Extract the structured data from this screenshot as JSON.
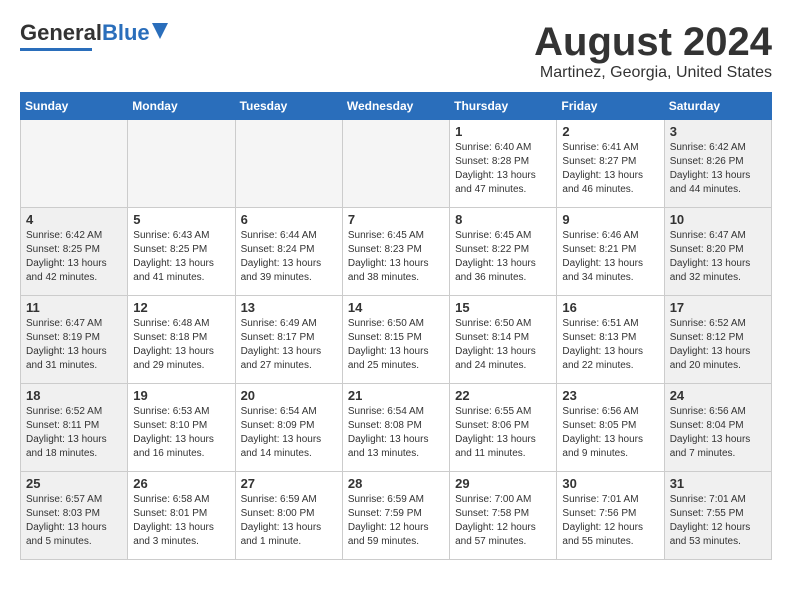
{
  "header": {
    "logo_general": "General",
    "logo_blue": "Blue",
    "month_title": "August 2024",
    "location": "Martinez, Georgia, United States"
  },
  "days_of_week": [
    "Sunday",
    "Monday",
    "Tuesday",
    "Wednesday",
    "Thursday",
    "Friday",
    "Saturday"
  ],
  "weeks": [
    [
      {
        "day": "",
        "empty": true
      },
      {
        "day": "",
        "empty": true
      },
      {
        "day": "",
        "empty": true
      },
      {
        "day": "",
        "empty": true
      },
      {
        "day": "1",
        "sunrise": "Sunrise: 6:40 AM",
        "sunset": "Sunset: 8:28 PM",
        "daylight": "Daylight: 13 hours and 47 minutes."
      },
      {
        "day": "2",
        "sunrise": "Sunrise: 6:41 AM",
        "sunset": "Sunset: 8:27 PM",
        "daylight": "Daylight: 13 hours and 46 minutes."
      },
      {
        "day": "3",
        "sunrise": "Sunrise: 6:42 AM",
        "sunset": "Sunset: 8:26 PM",
        "daylight": "Daylight: 13 hours and 44 minutes."
      }
    ],
    [
      {
        "day": "4",
        "sunrise": "Sunrise: 6:42 AM",
        "sunset": "Sunset: 8:25 PM",
        "daylight": "Daylight: 13 hours and 42 minutes."
      },
      {
        "day": "5",
        "sunrise": "Sunrise: 6:43 AM",
        "sunset": "Sunset: 8:25 PM",
        "daylight": "Daylight: 13 hours and 41 minutes."
      },
      {
        "day": "6",
        "sunrise": "Sunrise: 6:44 AM",
        "sunset": "Sunset: 8:24 PM",
        "daylight": "Daylight: 13 hours and 39 minutes."
      },
      {
        "day": "7",
        "sunrise": "Sunrise: 6:45 AM",
        "sunset": "Sunset: 8:23 PM",
        "daylight": "Daylight: 13 hours and 38 minutes."
      },
      {
        "day": "8",
        "sunrise": "Sunrise: 6:45 AM",
        "sunset": "Sunset: 8:22 PM",
        "daylight": "Daylight: 13 hours and 36 minutes."
      },
      {
        "day": "9",
        "sunrise": "Sunrise: 6:46 AM",
        "sunset": "Sunset: 8:21 PM",
        "daylight": "Daylight: 13 hours and 34 minutes."
      },
      {
        "day": "10",
        "sunrise": "Sunrise: 6:47 AM",
        "sunset": "Sunset: 8:20 PM",
        "daylight": "Daylight: 13 hours and 32 minutes."
      }
    ],
    [
      {
        "day": "11",
        "sunrise": "Sunrise: 6:47 AM",
        "sunset": "Sunset: 8:19 PM",
        "daylight": "Daylight: 13 hours and 31 minutes."
      },
      {
        "day": "12",
        "sunrise": "Sunrise: 6:48 AM",
        "sunset": "Sunset: 8:18 PM",
        "daylight": "Daylight: 13 hours and 29 minutes."
      },
      {
        "day": "13",
        "sunrise": "Sunrise: 6:49 AM",
        "sunset": "Sunset: 8:17 PM",
        "daylight": "Daylight: 13 hours and 27 minutes."
      },
      {
        "day": "14",
        "sunrise": "Sunrise: 6:50 AM",
        "sunset": "Sunset: 8:15 PM",
        "daylight": "Daylight: 13 hours and 25 minutes."
      },
      {
        "day": "15",
        "sunrise": "Sunrise: 6:50 AM",
        "sunset": "Sunset: 8:14 PM",
        "daylight": "Daylight: 13 hours and 24 minutes."
      },
      {
        "day": "16",
        "sunrise": "Sunrise: 6:51 AM",
        "sunset": "Sunset: 8:13 PM",
        "daylight": "Daylight: 13 hours and 22 minutes."
      },
      {
        "day": "17",
        "sunrise": "Sunrise: 6:52 AM",
        "sunset": "Sunset: 8:12 PM",
        "daylight": "Daylight: 13 hours and 20 minutes."
      }
    ],
    [
      {
        "day": "18",
        "sunrise": "Sunrise: 6:52 AM",
        "sunset": "Sunset: 8:11 PM",
        "daylight": "Daylight: 13 hours and 18 minutes."
      },
      {
        "day": "19",
        "sunrise": "Sunrise: 6:53 AM",
        "sunset": "Sunset: 8:10 PM",
        "daylight": "Daylight: 13 hours and 16 minutes."
      },
      {
        "day": "20",
        "sunrise": "Sunrise: 6:54 AM",
        "sunset": "Sunset: 8:09 PM",
        "daylight": "Daylight: 13 hours and 14 minutes."
      },
      {
        "day": "21",
        "sunrise": "Sunrise: 6:54 AM",
        "sunset": "Sunset: 8:08 PM",
        "daylight": "Daylight: 13 hours and 13 minutes."
      },
      {
        "day": "22",
        "sunrise": "Sunrise: 6:55 AM",
        "sunset": "Sunset: 8:06 PM",
        "daylight": "Daylight: 13 hours and 11 minutes."
      },
      {
        "day": "23",
        "sunrise": "Sunrise: 6:56 AM",
        "sunset": "Sunset: 8:05 PM",
        "daylight": "Daylight: 13 hours and 9 minutes."
      },
      {
        "day": "24",
        "sunrise": "Sunrise: 6:56 AM",
        "sunset": "Sunset: 8:04 PM",
        "daylight": "Daylight: 13 hours and 7 minutes."
      }
    ],
    [
      {
        "day": "25",
        "sunrise": "Sunrise: 6:57 AM",
        "sunset": "Sunset: 8:03 PM",
        "daylight": "Daylight: 13 hours and 5 minutes."
      },
      {
        "day": "26",
        "sunrise": "Sunrise: 6:58 AM",
        "sunset": "Sunset: 8:01 PM",
        "daylight": "Daylight: 13 hours and 3 minutes."
      },
      {
        "day": "27",
        "sunrise": "Sunrise: 6:59 AM",
        "sunset": "Sunset: 8:00 PM",
        "daylight": "Daylight: 13 hours and 1 minute."
      },
      {
        "day": "28",
        "sunrise": "Sunrise: 6:59 AM",
        "sunset": "Sunset: 7:59 PM",
        "daylight": "Daylight: 12 hours and 59 minutes."
      },
      {
        "day": "29",
        "sunrise": "Sunrise: 7:00 AM",
        "sunset": "Sunset: 7:58 PM",
        "daylight": "Daylight: 12 hours and 57 minutes."
      },
      {
        "day": "30",
        "sunrise": "Sunrise: 7:01 AM",
        "sunset": "Sunset: 7:56 PM",
        "daylight": "Daylight: 12 hours and 55 minutes."
      },
      {
        "day": "31",
        "sunrise": "Sunrise: 7:01 AM",
        "sunset": "Sunset: 7:55 PM",
        "daylight": "Daylight: 12 hours and 53 minutes."
      }
    ]
  ]
}
